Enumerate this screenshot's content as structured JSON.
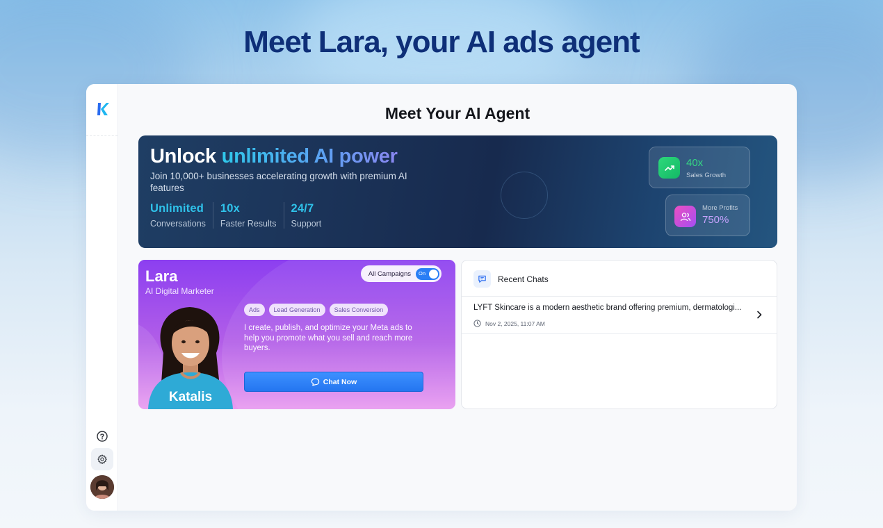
{
  "hero": {
    "title": "Meet Lara, your AI ads agent"
  },
  "sidebar": {
    "logo": "katalis-logo",
    "icons": [
      "help-icon",
      "gear-icon"
    ],
    "avatar": "user-avatar"
  },
  "page": {
    "title": "Meet Your AI Agent"
  },
  "banner": {
    "title_plain": "Unlock",
    "title_highlight": "unlimited AI power",
    "subtitle": "Join 10,000+ businesses accelerating growth with premium AI features",
    "stats": [
      {
        "value": "Unlimited",
        "label": "Conversations"
      },
      {
        "value": "10x",
        "label": "Faster Results"
      },
      {
        "value": "24/7",
        "label": "Support"
      }
    ],
    "metrics": [
      {
        "value": "40x",
        "label": "Sales Growth",
        "icon": "trending-up-icon",
        "color": "#35d884"
      },
      {
        "value": "750%",
        "label": "More Profits",
        "icon": "users-icon",
        "color": "#c7a3ff"
      }
    ],
    "highlight_color": "#2fc2ea"
  },
  "agent": {
    "name": "Lara",
    "role": "AI Digital Marketer",
    "toggle_label": "All Campaigns",
    "toggle_state": "On",
    "tags": [
      "Ads",
      "Lead Generation",
      "Sales Conversion"
    ],
    "description": "I create, publish, and optimize your Meta ads to help you promote what you sell and reach more buyers.",
    "chat_button": "Chat Now",
    "shirt_brand": "Katalis",
    "accent": "#8c3ff0"
  },
  "recent_chats": {
    "title": "Recent Chats",
    "items": [
      {
        "text": "LYFT Skincare is a modern aesthetic brand offering premium, dermatologi...",
        "timestamp": "Nov 2, 2025, 11:07 AM"
      }
    ]
  }
}
